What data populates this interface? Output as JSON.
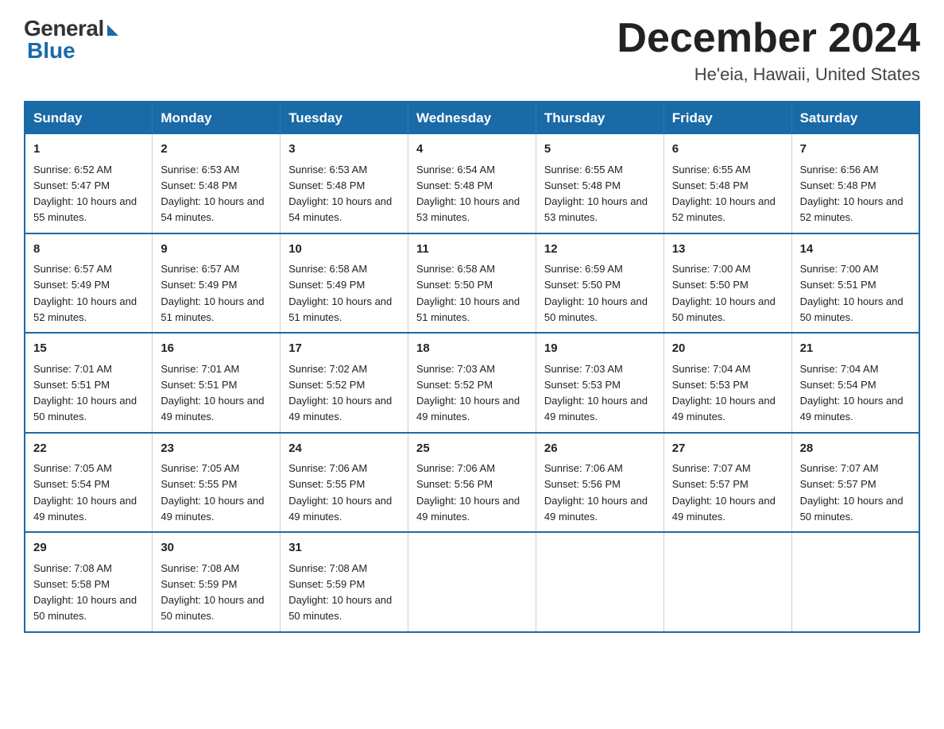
{
  "logo": {
    "general": "General",
    "blue": "Blue"
  },
  "title": "December 2024",
  "subtitle": "He'eia, Hawaii, United States",
  "days_header": [
    "Sunday",
    "Monday",
    "Tuesday",
    "Wednesday",
    "Thursday",
    "Friday",
    "Saturday"
  ],
  "weeks": [
    [
      {
        "day": "1",
        "sunrise": "6:52 AM",
        "sunset": "5:47 PM",
        "daylight": "10 hours and 55 minutes."
      },
      {
        "day": "2",
        "sunrise": "6:53 AM",
        "sunset": "5:48 PM",
        "daylight": "10 hours and 54 minutes."
      },
      {
        "day": "3",
        "sunrise": "6:53 AM",
        "sunset": "5:48 PM",
        "daylight": "10 hours and 54 minutes."
      },
      {
        "day": "4",
        "sunrise": "6:54 AM",
        "sunset": "5:48 PM",
        "daylight": "10 hours and 53 minutes."
      },
      {
        "day": "5",
        "sunrise": "6:55 AM",
        "sunset": "5:48 PM",
        "daylight": "10 hours and 53 minutes."
      },
      {
        "day": "6",
        "sunrise": "6:55 AM",
        "sunset": "5:48 PM",
        "daylight": "10 hours and 52 minutes."
      },
      {
        "day": "7",
        "sunrise": "6:56 AM",
        "sunset": "5:48 PM",
        "daylight": "10 hours and 52 minutes."
      }
    ],
    [
      {
        "day": "8",
        "sunrise": "6:57 AM",
        "sunset": "5:49 PM",
        "daylight": "10 hours and 52 minutes."
      },
      {
        "day": "9",
        "sunrise": "6:57 AM",
        "sunset": "5:49 PM",
        "daylight": "10 hours and 51 minutes."
      },
      {
        "day": "10",
        "sunrise": "6:58 AM",
        "sunset": "5:49 PM",
        "daylight": "10 hours and 51 minutes."
      },
      {
        "day": "11",
        "sunrise": "6:58 AM",
        "sunset": "5:50 PM",
        "daylight": "10 hours and 51 minutes."
      },
      {
        "day": "12",
        "sunrise": "6:59 AM",
        "sunset": "5:50 PM",
        "daylight": "10 hours and 50 minutes."
      },
      {
        "day": "13",
        "sunrise": "7:00 AM",
        "sunset": "5:50 PM",
        "daylight": "10 hours and 50 minutes."
      },
      {
        "day": "14",
        "sunrise": "7:00 AM",
        "sunset": "5:51 PM",
        "daylight": "10 hours and 50 minutes."
      }
    ],
    [
      {
        "day": "15",
        "sunrise": "7:01 AM",
        "sunset": "5:51 PM",
        "daylight": "10 hours and 50 minutes."
      },
      {
        "day": "16",
        "sunrise": "7:01 AM",
        "sunset": "5:51 PM",
        "daylight": "10 hours and 49 minutes."
      },
      {
        "day": "17",
        "sunrise": "7:02 AM",
        "sunset": "5:52 PM",
        "daylight": "10 hours and 49 minutes."
      },
      {
        "day": "18",
        "sunrise": "7:03 AM",
        "sunset": "5:52 PM",
        "daylight": "10 hours and 49 minutes."
      },
      {
        "day": "19",
        "sunrise": "7:03 AM",
        "sunset": "5:53 PM",
        "daylight": "10 hours and 49 minutes."
      },
      {
        "day": "20",
        "sunrise": "7:04 AM",
        "sunset": "5:53 PM",
        "daylight": "10 hours and 49 minutes."
      },
      {
        "day": "21",
        "sunrise": "7:04 AM",
        "sunset": "5:54 PM",
        "daylight": "10 hours and 49 minutes."
      }
    ],
    [
      {
        "day": "22",
        "sunrise": "7:05 AM",
        "sunset": "5:54 PM",
        "daylight": "10 hours and 49 minutes."
      },
      {
        "day": "23",
        "sunrise": "7:05 AM",
        "sunset": "5:55 PM",
        "daylight": "10 hours and 49 minutes."
      },
      {
        "day": "24",
        "sunrise": "7:06 AM",
        "sunset": "5:55 PM",
        "daylight": "10 hours and 49 minutes."
      },
      {
        "day": "25",
        "sunrise": "7:06 AM",
        "sunset": "5:56 PM",
        "daylight": "10 hours and 49 minutes."
      },
      {
        "day": "26",
        "sunrise": "7:06 AM",
        "sunset": "5:56 PM",
        "daylight": "10 hours and 49 minutes."
      },
      {
        "day": "27",
        "sunrise": "7:07 AM",
        "sunset": "5:57 PM",
        "daylight": "10 hours and 49 minutes."
      },
      {
        "day": "28",
        "sunrise": "7:07 AM",
        "sunset": "5:57 PM",
        "daylight": "10 hours and 50 minutes."
      }
    ],
    [
      {
        "day": "29",
        "sunrise": "7:08 AM",
        "sunset": "5:58 PM",
        "daylight": "10 hours and 50 minutes."
      },
      {
        "day": "30",
        "sunrise": "7:08 AM",
        "sunset": "5:59 PM",
        "daylight": "10 hours and 50 minutes."
      },
      {
        "day": "31",
        "sunrise": "7:08 AM",
        "sunset": "5:59 PM",
        "daylight": "10 hours and 50 minutes."
      },
      null,
      null,
      null,
      null
    ]
  ]
}
